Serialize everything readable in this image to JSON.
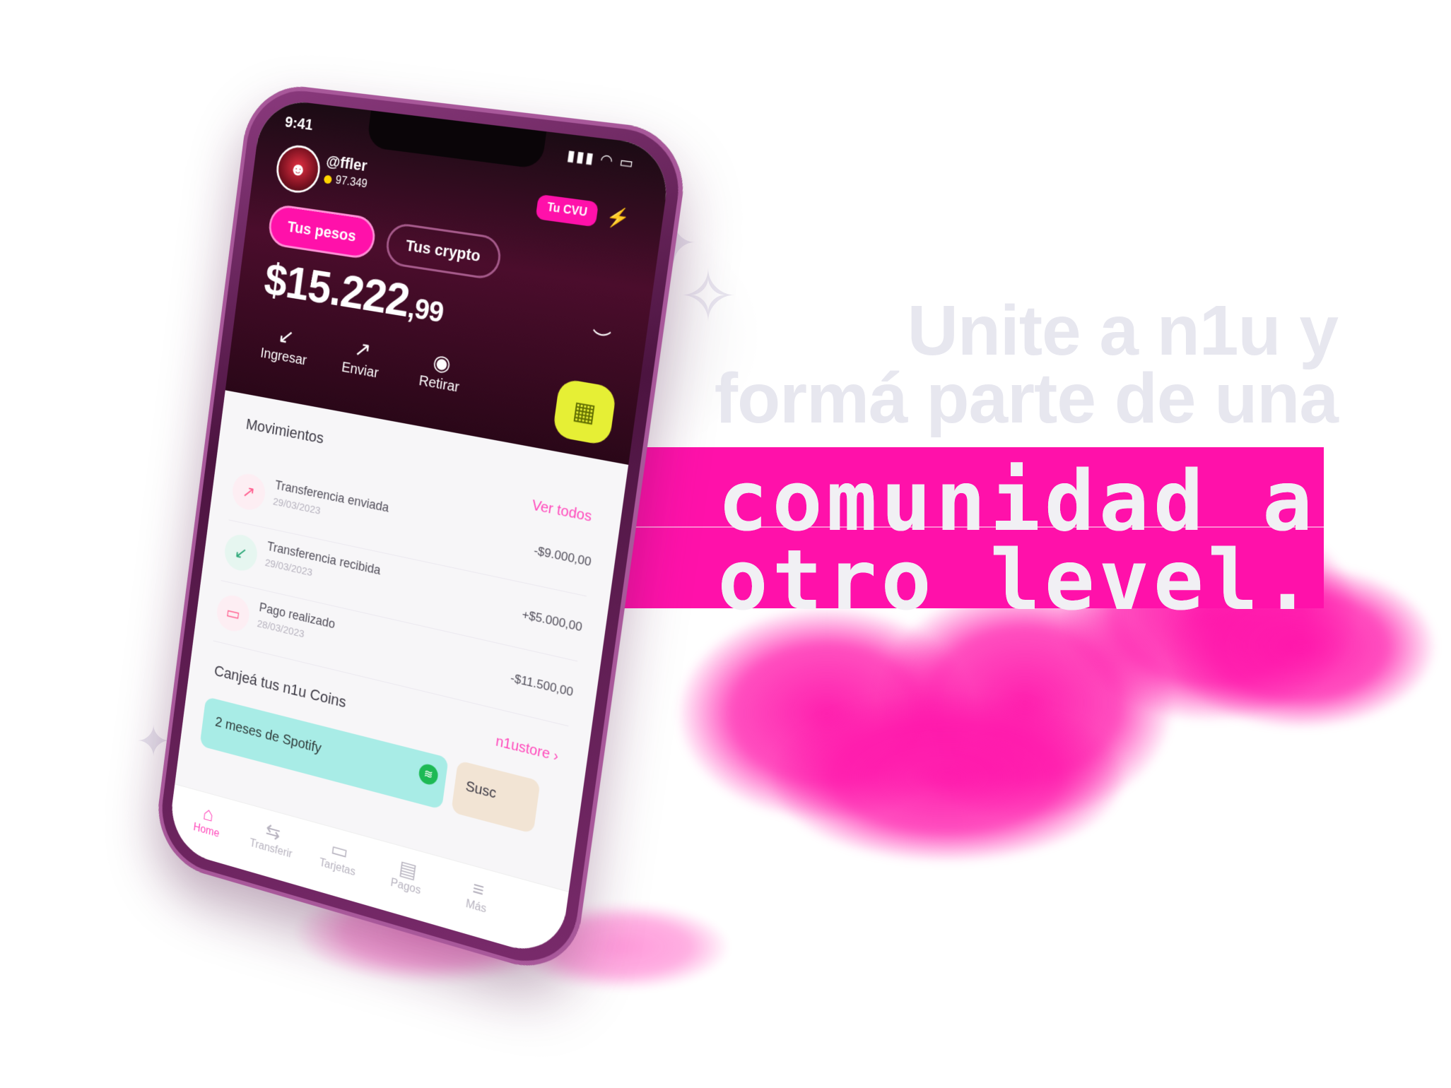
{
  "headline": {
    "line1": "Unite a n1u y",
    "line2": "formá parte de una",
    "pixel_line1": "comunidad a",
    "pixel_line2": "otro level."
  },
  "phone": {
    "status_time": "9:41",
    "status_icons": "▮▮▮ ◠ ▭",
    "username": "@ffler",
    "coins": "97.349",
    "cvu_button": "Tu CVU",
    "tabs": [
      "Tus pesos",
      "Tus crypto"
    ],
    "balance_main": "$15.222",
    "balance_cents": ",99",
    "actions": [
      {
        "label": "Ingresar",
        "icon": "↙"
      },
      {
        "label": "Enviar",
        "icon": "↗"
      },
      {
        "label": "Retirar",
        "icon": "◉"
      }
    ],
    "qr_icon": "▦",
    "movements_title": "Movimientos",
    "see_all": "Ver todos",
    "movements": [
      {
        "title": "Transferencia enviada",
        "date": "29/03/2023",
        "amount": "-$9.000,00",
        "icon": "↗"
      },
      {
        "title": "Transferencia recibida",
        "date": "29/03/2023",
        "amount": "+$5.000,00",
        "icon": "↙"
      },
      {
        "title": "Pago realizado",
        "date": "28/03/2023",
        "amount": "-$11.500,00",
        "icon": "▭"
      }
    ],
    "coins_title": "Canjeá tus n1u Coins",
    "store_link": "n1ustore ›",
    "promo_1": "2 meses de Spotify",
    "promo_2": "Susc",
    "nav": [
      {
        "label": "Home",
        "icon": "⌂"
      },
      {
        "label": "Transferir",
        "icon": "⇆"
      },
      {
        "label": "Tarjetas",
        "icon": "▭"
      },
      {
        "label": "Pagos",
        "icon": "▤"
      },
      {
        "label": "Más",
        "icon": "≡"
      }
    ]
  },
  "colors": {
    "brand_pink": "#ff11aa",
    "qr_yellow": "#e6ef35",
    "headline_gray": "#e7e7ef"
  }
}
